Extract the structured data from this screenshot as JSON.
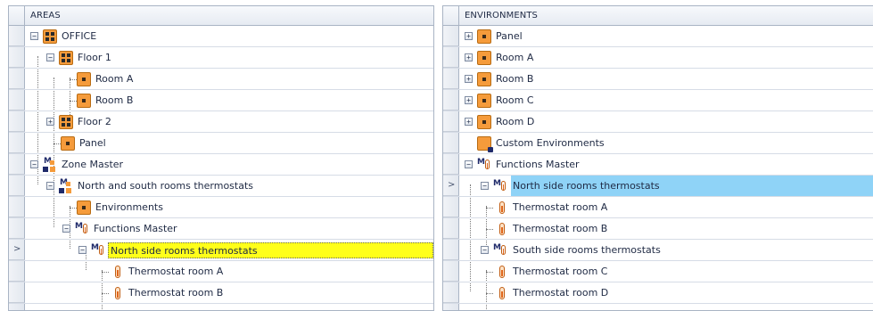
{
  "areas_panel": {
    "header": "AREAS",
    "rows": [
      {
        "label": "OFFICE",
        "icon": "building-icon"
      },
      {
        "label": "Floor 1",
        "icon": "building-icon"
      },
      {
        "label": "Room A",
        "icon": "room-icon"
      },
      {
        "label": "Room B",
        "icon": "room-icon"
      },
      {
        "label": "Floor 2",
        "icon": "building-icon"
      },
      {
        "label": "Panel",
        "icon": "room-icon"
      },
      {
        "label": "Zone Master",
        "icon": "zone-master-icon"
      },
      {
        "label": "North and south rooms thermostats",
        "icon": "zone-master-icon"
      },
      {
        "label": "Environments",
        "icon": "room-icon"
      },
      {
        "label": "Functions Master",
        "icon": "functions-master-icon"
      },
      {
        "label": "North side rooms thermostats",
        "icon": "functions-master-icon",
        "selected": true
      },
      {
        "label": "Thermostat room A",
        "icon": "thermostat-icon"
      },
      {
        "label": "Thermostat room B",
        "icon": "thermostat-icon"
      }
    ],
    "expanders": {
      "r0": "−",
      "r1": "−",
      "r4": "+",
      "r6": "−",
      "r7": "−",
      "r9": "−",
      "r10": "−"
    },
    "current_row_marker": ">"
  },
  "environments_panel": {
    "header": "ENVIRONMENTS",
    "rows": [
      {
        "label": "Panel",
        "icon": "room-icon"
      },
      {
        "label": "Room A",
        "icon": "room-icon"
      },
      {
        "label": "Room B",
        "icon": "room-icon"
      },
      {
        "label": "Room C",
        "icon": "room-icon"
      },
      {
        "label": "Room D",
        "icon": "room-icon"
      },
      {
        "label": "Custom Environments",
        "icon": "custom-environment-icon"
      },
      {
        "label": "Functions Master",
        "icon": "functions-master-icon"
      },
      {
        "label": "North side rooms thermostats",
        "icon": "functions-master-icon",
        "selected": true
      },
      {
        "label": "Thermostat room A",
        "icon": "thermostat-icon"
      },
      {
        "label": "Thermostat room B",
        "icon": "thermostat-icon"
      },
      {
        "label": "South side rooms thermostats",
        "icon": "functions-master-icon"
      },
      {
        "label": "Thermostat room C",
        "icon": "thermostat-icon"
      },
      {
        "label": "Thermostat room D",
        "icon": "thermostat-icon"
      }
    ],
    "expanders": {
      "r0": "+",
      "r1": "+",
      "r2": "+",
      "r3": "+",
      "r4": "+",
      "r6": "−",
      "r7": "−",
      "r10": "−"
    },
    "current_row_marker": ">"
  },
  "colors": {
    "selection_yellow": "#ffff1a",
    "selection_blue": "#8fd3f7",
    "room_orange": "#f59b3b",
    "navy": "#1f2a6a"
  }
}
